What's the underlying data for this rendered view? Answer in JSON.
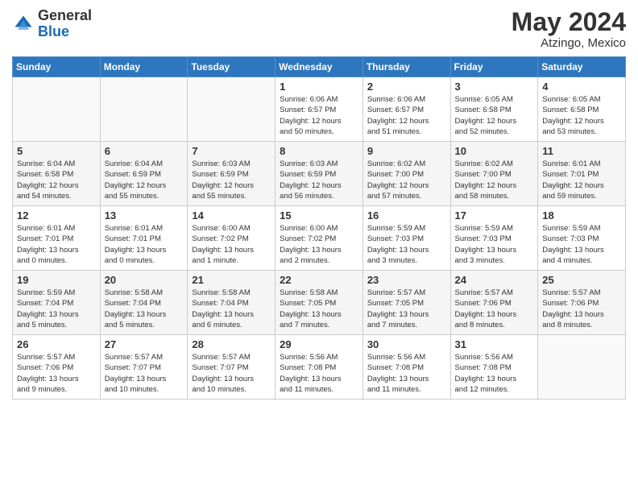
{
  "logo": {
    "general": "General",
    "blue": "Blue"
  },
  "header": {
    "month": "May 2024",
    "location": "Atzingo, Mexico"
  },
  "weekdays": [
    "Sunday",
    "Monday",
    "Tuesday",
    "Wednesday",
    "Thursday",
    "Friday",
    "Saturday"
  ],
  "weeks": [
    [
      {
        "day": "",
        "info": ""
      },
      {
        "day": "",
        "info": ""
      },
      {
        "day": "",
        "info": ""
      },
      {
        "day": "1",
        "info": "Sunrise: 6:06 AM\nSunset: 6:57 PM\nDaylight: 12 hours\nand 50 minutes."
      },
      {
        "day": "2",
        "info": "Sunrise: 6:06 AM\nSunset: 6:57 PM\nDaylight: 12 hours\nand 51 minutes."
      },
      {
        "day": "3",
        "info": "Sunrise: 6:05 AM\nSunset: 6:58 PM\nDaylight: 12 hours\nand 52 minutes."
      },
      {
        "day": "4",
        "info": "Sunrise: 6:05 AM\nSunset: 6:58 PM\nDaylight: 12 hours\nand 53 minutes."
      }
    ],
    [
      {
        "day": "5",
        "info": "Sunrise: 6:04 AM\nSunset: 6:58 PM\nDaylight: 12 hours\nand 54 minutes."
      },
      {
        "day": "6",
        "info": "Sunrise: 6:04 AM\nSunset: 6:59 PM\nDaylight: 12 hours\nand 55 minutes."
      },
      {
        "day": "7",
        "info": "Sunrise: 6:03 AM\nSunset: 6:59 PM\nDaylight: 12 hours\nand 55 minutes."
      },
      {
        "day": "8",
        "info": "Sunrise: 6:03 AM\nSunset: 6:59 PM\nDaylight: 12 hours\nand 56 minutes."
      },
      {
        "day": "9",
        "info": "Sunrise: 6:02 AM\nSunset: 7:00 PM\nDaylight: 12 hours\nand 57 minutes."
      },
      {
        "day": "10",
        "info": "Sunrise: 6:02 AM\nSunset: 7:00 PM\nDaylight: 12 hours\nand 58 minutes."
      },
      {
        "day": "11",
        "info": "Sunrise: 6:01 AM\nSunset: 7:01 PM\nDaylight: 12 hours\nand 59 minutes."
      }
    ],
    [
      {
        "day": "12",
        "info": "Sunrise: 6:01 AM\nSunset: 7:01 PM\nDaylight: 13 hours\nand 0 minutes."
      },
      {
        "day": "13",
        "info": "Sunrise: 6:01 AM\nSunset: 7:01 PM\nDaylight: 13 hours\nand 0 minutes."
      },
      {
        "day": "14",
        "info": "Sunrise: 6:00 AM\nSunset: 7:02 PM\nDaylight: 13 hours\nand 1 minute."
      },
      {
        "day": "15",
        "info": "Sunrise: 6:00 AM\nSunset: 7:02 PM\nDaylight: 13 hours\nand 2 minutes."
      },
      {
        "day": "16",
        "info": "Sunrise: 5:59 AM\nSunset: 7:03 PM\nDaylight: 13 hours\nand 3 minutes."
      },
      {
        "day": "17",
        "info": "Sunrise: 5:59 AM\nSunset: 7:03 PM\nDaylight: 13 hours\nand 3 minutes."
      },
      {
        "day": "18",
        "info": "Sunrise: 5:59 AM\nSunset: 7:03 PM\nDaylight: 13 hours\nand 4 minutes."
      }
    ],
    [
      {
        "day": "19",
        "info": "Sunrise: 5:59 AM\nSunset: 7:04 PM\nDaylight: 13 hours\nand 5 minutes."
      },
      {
        "day": "20",
        "info": "Sunrise: 5:58 AM\nSunset: 7:04 PM\nDaylight: 13 hours\nand 5 minutes."
      },
      {
        "day": "21",
        "info": "Sunrise: 5:58 AM\nSunset: 7:04 PM\nDaylight: 13 hours\nand 6 minutes."
      },
      {
        "day": "22",
        "info": "Sunrise: 5:58 AM\nSunset: 7:05 PM\nDaylight: 13 hours\nand 7 minutes."
      },
      {
        "day": "23",
        "info": "Sunrise: 5:57 AM\nSunset: 7:05 PM\nDaylight: 13 hours\nand 7 minutes."
      },
      {
        "day": "24",
        "info": "Sunrise: 5:57 AM\nSunset: 7:06 PM\nDaylight: 13 hours\nand 8 minutes."
      },
      {
        "day": "25",
        "info": "Sunrise: 5:57 AM\nSunset: 7:06 PM\nDaylight: 13 hours\nand 8 minutes."
      }
    ],
    [
      {
        "day": "26",
        "info": "Sunrise: 5:57 AM\nSunset: 7:06 PM\nDaylight: 13 hours\nand 9 minutes."
      },
      {
        "day": "27",
        "info": "Sunrise: 5:57 AM\nSunset: 7:07 PM\nDaylight: 13 hours\nand 10 minutes."
      },
      {
        "day": "28",
        "info": "Sunrise: 5:57 AM\nSunset: 7:07 PM\nDaylight: 13 hours\nand 10 minutes."
      },
      {
        "day": "29",
        "info": "Sunrise: 5:56 AM\nSunset: 7:08 PM\nDaylight: 13 hours\nand 11 minutes."
      },
      {
        "day": "30",
        "info": "Sunrise: 5:56 AM\nSunset: 7:08 PM\nDaylight: 13 hours\nand 11 minutes."
      },
      {
        "day": "31",
        "info": "Sunrise: 5:56 AM\nSunset: 7:08 PM\nDaylight: 13 hours\nand 12 minutes."
      },
      {
        "day": "",
        "info": ""
      }
    ]
  ]
}
